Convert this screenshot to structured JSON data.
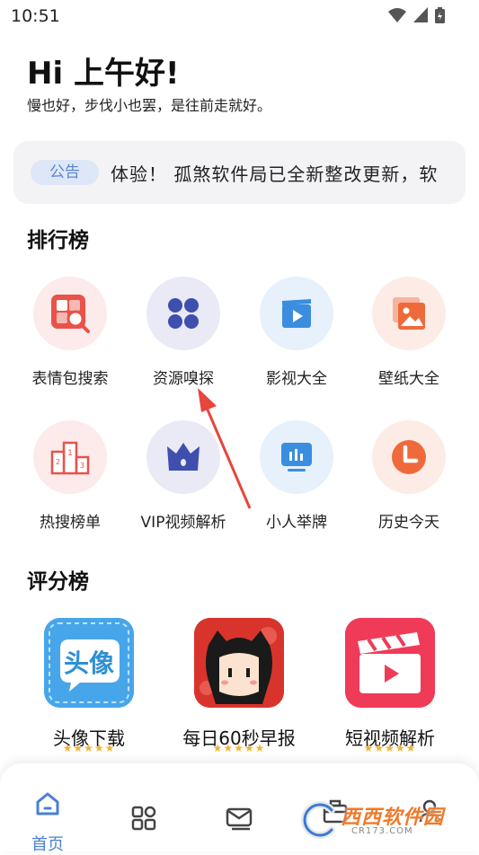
{
  "status_bar": {
    "time": "10:51"
  },
  "greeting": {
    "title": "Hi 上午好!",
    "subtitle": "慢也好，步伐小也罢，是往前走就好。"
  },
  "notice": {
    "badge": "公告",
    "text": "体验！  孤煞软件局已全新整改更新，软"
  },
  "ranking": {
    "title": "排行榜",
    "items": [
      {
        "label": "表情包搜索",
        "icon": "image-search-icon",
        "color": "#e8534a"
      },
      {
        "label": "资源嗅探",
        "icon": "clover-icon",
        "color": "#3f4fae"
      },
      {
        "label": "影视大全",
        "icon": "play-video-icon",
        "color": "#3b8de0"
      },
      {
        "label": "壁纸大全",
        "icon": "picture-icon",
        "color": "#ef6a3a"
      },
      {
        "label": "热搜榜单",
        "icon": "podium-icon",
        "color": "#e8534a"
      },
      {
        "label": "VIP视频解析",
        "icon": "crown-icon",
        "color": "#3f4fae"
      },
      {
        "label": "小人举牌",
        "icon": "sign-board-icon",
        "color": "#3b8de0"
      },
      {
        "label": "历史今天",
        "icon": "clock-icon",
        "color": "#ef6a3a"
      }
    ]
  },
  "rating": {
    "title": "评分榜",
    "items": [
      {
        "label": "头像下载",
        "icon_text": "头像",
        "stars": "★★★★★"
      },
      {
        "label": "每日60秒早报",
        "icon_text": "",
        "stars": "★★★★★"
      },
      {
        "label": "短视频解析",
        "icon_text": "",
        "stars": "★★★★★"
      }
    ]
  },
  "bottom_nav": {
    "items": [
      {
        "label": "首页",
        "icon": "home-icon",
        "active": true
      },
      {
        "label": "",
        "icon": "apps-grid-icon",
        "active": false
      },
      {
        "label": "",
        "icon": "mail-icon",
        "active": false
      },
      {
        "label": "",
        "icon": "toolbox-icon",
        "active": false
      },
      {
        "label": "",
        "icon": "user-icon",
        "active": false
      }
    ]
  },
  "watermark": {
    "text": "西西软件园",
    "sub": "CR173.COM"
  },
  "colors": {
    "accent": "#4a7fd6",
    "badge_bg": "#dde7f7",
    "card_bg": "#f3f3f5"
  }
}
